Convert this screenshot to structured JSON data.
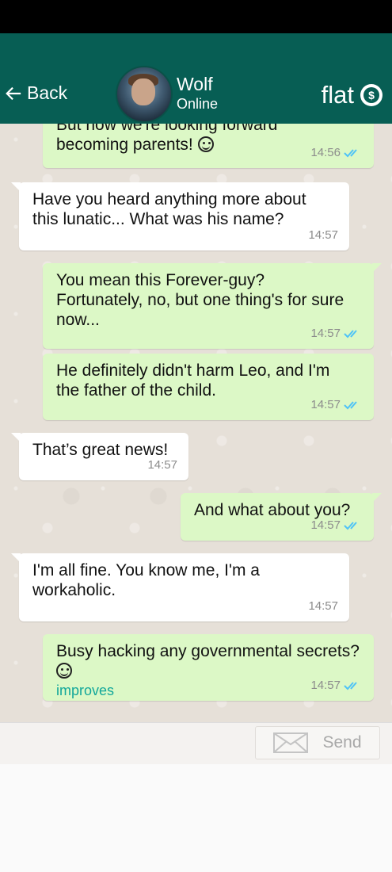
{
  "header": {
    "back_label": "Back",
    "contact_name": "Wolf",
    "contact_status": "Online",
    "brand": "flat"
  },
  "colors": {
    "header": "#075e54",
    "outgoing": "#dcf8c6",
    "incoming": "#ffffff",
    "tick": "#4fc3f7",
    "link": "#12a79a"
  },
  "messages": [
    {
      "dir": "out",
      "text_partial": "But now we're looking forward",
      "text": "becoming parents!",
      "time": "14:56",
      "ticks": "double-check"
    },
    {
      "dir": "in",
      "text": "Have you heard anything more about this lunatic... What was his name?",
      "time": "14:57"
    },
    {
      "dir": "out",
      "text": "You mean this Forever-guy? Fortunately, no, but one thing's for sure now...",
      "time": "14:57",
      "ticks": "double-check"
    },
    {
      "dir": "out",
      "text": "He definitely didn't harm Leo, and I'm the father of the child.",
      "time": "14:57",
      "ticks": "double-check"
    },
    {
      "dir": "in",
      "text": "That’s great news!",
      "time": "14:57"
    },
    {
      "dir": "out",
      "text": "And what about you?",
      "time": "14:57",
      "ticks": "double-check"
    },
    {
      "dir": "in",
      "text": "I'm all fine. You know me, I'm a workaholic.",
      "time": "14:57"
    },
    {
      "dir": "out",
      "text": "Busy hacking any governmental secrets?",
      "link": "improves",
      "time": "14:57",
      "ticks": "double-check"
    }
  ],
  "composer": {
    "send_label": "Send",
    "send_icon": "envelope-icon"
  }
}
